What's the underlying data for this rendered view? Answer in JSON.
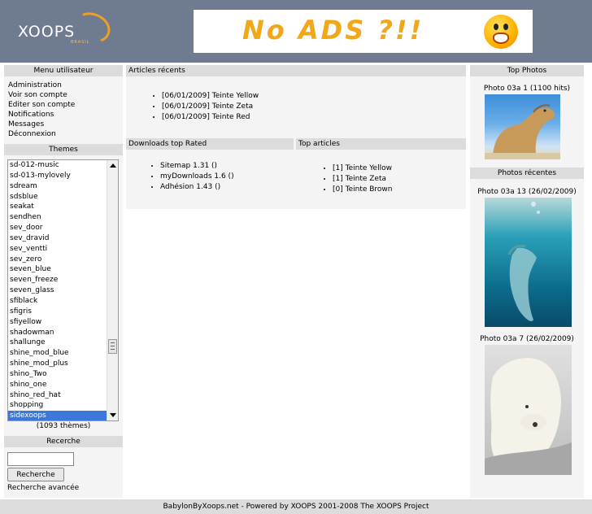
{
  "header": {
    "logo_text": "XOOPS",
    "logo_sub": "BRASIL",
    "banner_text": "No ADS ?!!"
  },
  "left": {
    "menu_title": "Menu utilisateur",
    "menu_items": [
      "Administration",
      "Voir son compte",
      "Editer son compte",
      "Notifications",
      "Messages",
      "Déconnexion"
    ],
    "themes_title": "Themes",
    "theme_options": [
      "sd-012-music",
      "sd-013-mylovely",
      "sdream",
      "sdsblue",
      "seakat",
      "sendhen",
      "sev_door",
      "sev_dravid",
      "sev_ventti",
      "sev_zero",
      "seven_blue",
      "seven_freeze",
      "seven_glass",
      "sfiblack",
      "sfigris",
      "sfiyellow",
      "shadowman",
      "shallunge",
      "shine_mod_blue",
      "shine_mod_plus",
      "shino_Two",
      "shino_one",
      "shino_red_hat",
      "shopping",
      "sidexoops"
    ],
    "selected_theme": "sidexoops",
    "theme_count": "(1093 thèmes)",
    "search_title": "Recerche",
    "search_value": "",
    "search_button": "Recherche",
    "advanced_search": "Recherche avancée"
  },
  "center": {
    "recent_title": "Articles récents",
    "recent_items": [
      "[06/01/2009] Teinte Yellow",
      "[06/01/2009] Teinte Zeta",
      "[06/01/2009] Teinte Red"
    ],
    "downloads_title": "Downloads top Rated",
    "downloads_items": [
      "Sitemap 1.31 ()",
      "myDownloads 1.6 ()",
      "Adhésion 1.43 ()"
    ],
    "top_articles_title": "Top articles",
    "top_articles_items": [
      "[1] Teinte Yellow",
      "[1] Teinte Zeta",
      "[0] Teinte Brown"
    ]
  },
  "right": {
    "top_photos_title": "Top Photos",
    "top_photo_caption": "Photo 03a 1 (1100 hits)",
    "recent_photos_title": "Photos récentes",
    "recent_photo_1_caption": "Photo 03a 13 (26/02/2009)",
    "recent_photo_2_caption": "Photo 03a 7 (26/02/2009)"
  },
  "footer": {
    "text": "BabylonByXoops.net - Powered by XOOPS 2001-2008 The XOOPS Project"
  },
  "colors": {
    "header": "#6f7b91",
    "block_title": "#dcdcdc",
    "block_bg": "#f4f4f4",
    "selection": "#3c78d8",
    "banner_text": "#f0a818"
  }
}
